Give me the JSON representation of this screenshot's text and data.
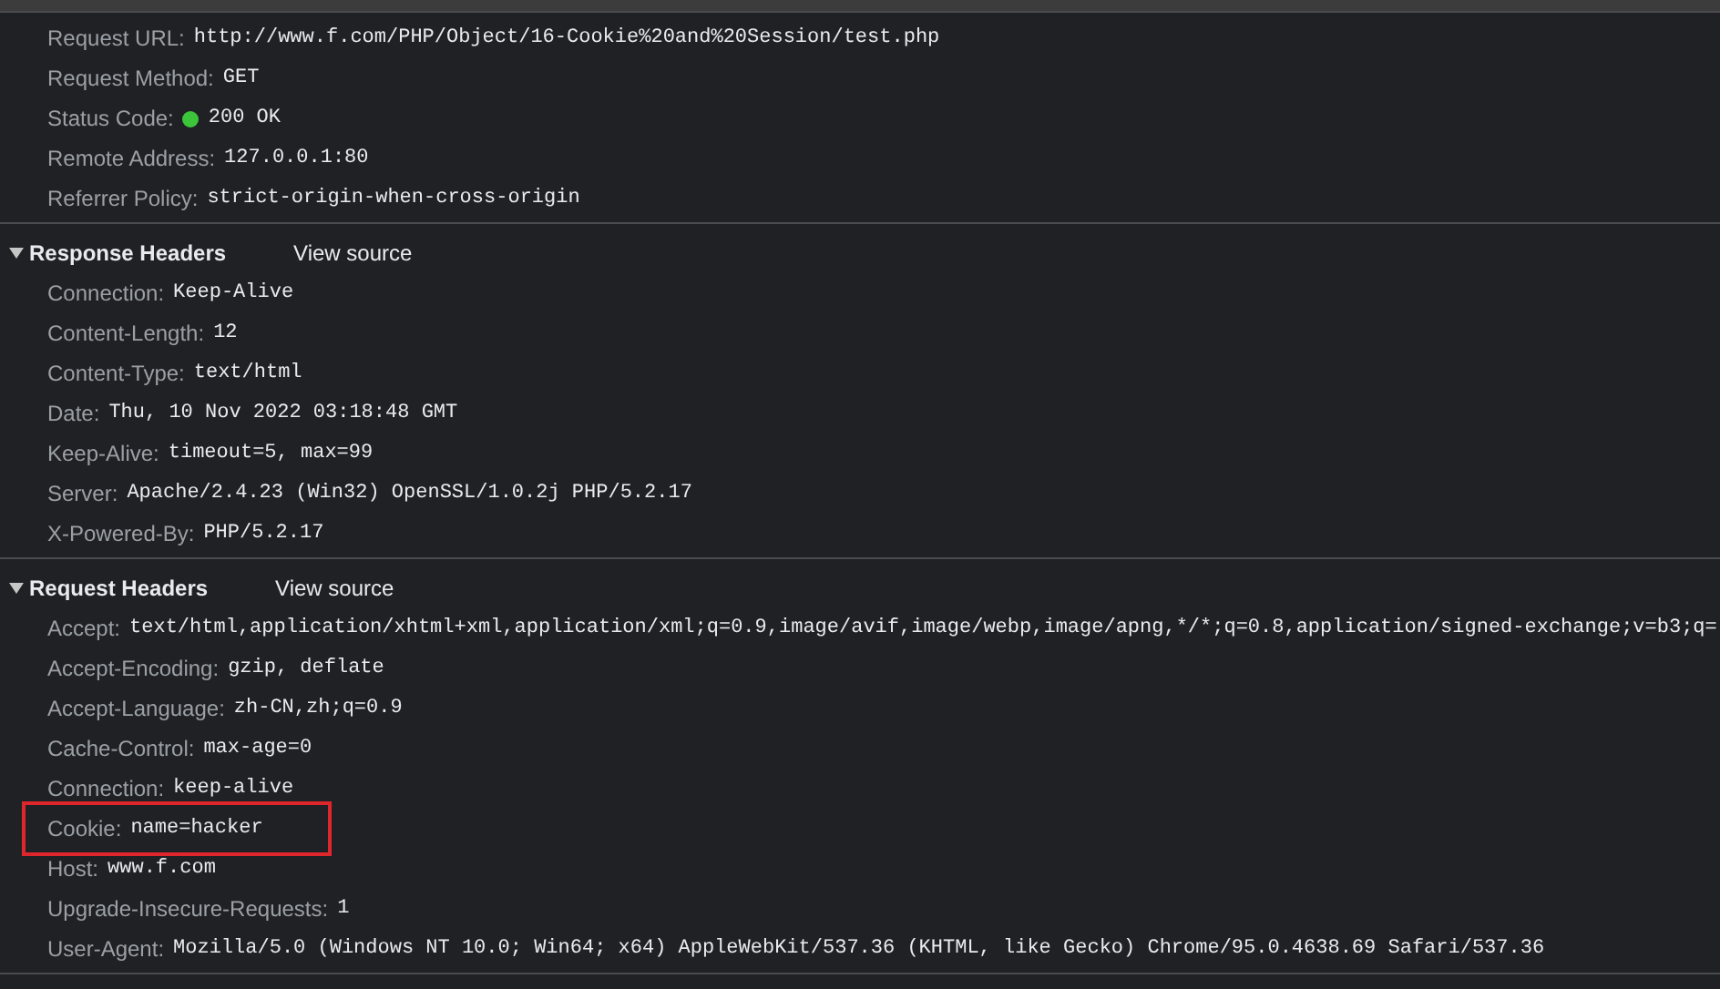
{
  "general": {
    "fields": [
      {
        "name": "Request URL:",
        "value": "http://www.f.com/PHP/Object/16-Cookie%20and%20Session/test.php"
      },
      {
        "name": "Request Method:",
        "value": "GET"
      },
      {
        "name": "Status Code:",
        "value": "200 OK",
        "kind": "status"
      },
      {
        "name": "Remote Address:",
        "value": "127.0.0.1:80"
      },
      {
        "name": "Referrer Policy:",
        "value": "strict-origin-when-cross-origin"
      }
    ]
  },
  "sections": [
    {
      "title": "Response Headers",
      "expanded": true,
      "link": "View source",
      "headers": [
        {
          "name": "Connection:",
          "value": "Keep-Alive",
          "highlighted": false
        },
        {
          "name": "Content-Length:",
          "value": "12",
          "highlighted": false
        },
        {
          "name": "Content-Type:",
          "value": "text/html",
          "highlighted": false
        },
        {
          "name": "Date:",
          "value": "Thu, 10 Nov 2022 03:18:48 GMT",
          "highlighted": false
        },
        {
          "name": "Keep-Alive:",
          "value": "timeout=5, max=99",
          "highlighted": false
        },
        {
          "name": "Server:",
          "value": "Apache/2.4.23 (Win32) OpenSSL/1.0.2j PHP/5.2.17",
          "highlighted": false
        },
        {
          "name": "X-Powered-By:",
          "value": "PHP/5.2.17",
          "highlighted": false
        }
      ]
    },
    {
      "title": "Request Headers",
      "expanded": true,
      "link": "View source",
      "headers": [
        {
          "name": "Accept:",
          "value": "text/html,application/xhtml+xml,application/xml;q=0.9,image/avif,image/webp,image/apng,*/*;q=0.8,application/signed-exchange;v=b3;q=",
          "highlighted": false
        },
        {
          "name": "Accept-Encoding:",
          "value": "gzip, deflate",
          "highlighted": false
        },
        {
          "name": "Accept-Language:",
          "value": "zh-CN,zh;q=0.9",
          "highlighted": false
        },
        {
          "name": "Cache-Control:",
          "value": "max-age=0",
          "highlighted": false
        },
        {
          "name": "Connection:",
          "value": "keep-alive",
          "highlighted": false
        },
        {
          "name": "Cookie:",
          "value": "name=hacker",
          "highlighted": true
        },
        {
          "name": "Host:",
          "value": "www.f.com",
          "highlighted": false
        },
        {
          "name": "Upgrade-Insecure-Requests:",
          "value": "1",
          "highlighted": false
        },
        {
          "name": "User-Agent:",
          "value": "Mozilla/5.0 (Windows NT 10.0; Win64; x64) AppleWebKit/537.36 (KHTML, like Gecko) Chrome/95.0.4638.69 Safari/537.36",
          "highlighted": false
        }
      ]
    }
  ]
}
